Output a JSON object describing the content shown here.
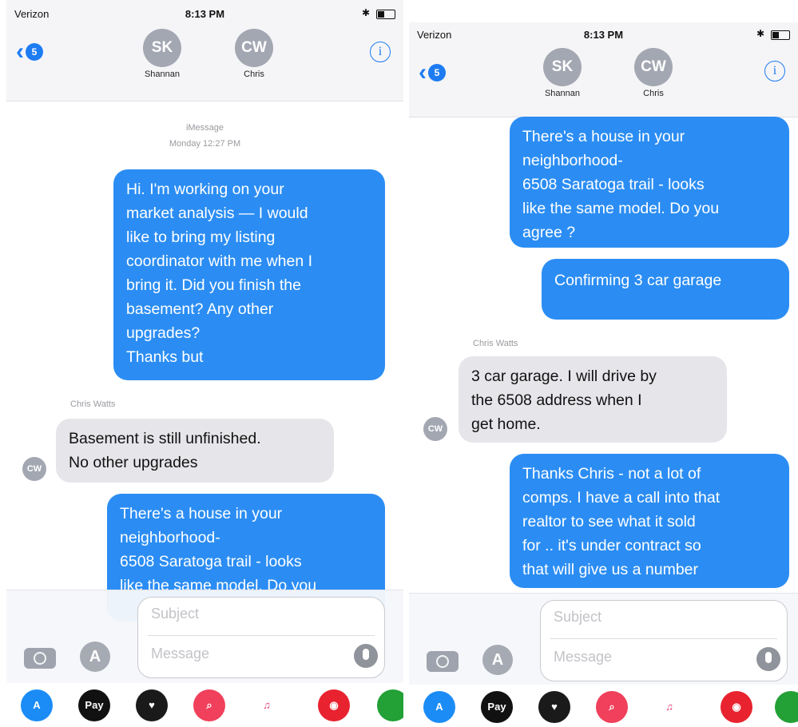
{
  "colors": {
    "outgoing": "#2b8df3",
    "incoming": "#e6e6ea",
    "accent": "#1e7cf2"
  },
  "left": {
    "status": {
      "carrier": "Verizon",
      "time": "8:13 PM"
    },
    "back_badge": "5",
    "contacts": [
      {
        "initials": "SK",
        "name": "Shannan"
      },
      {
        "initials": "CW",
        "name": "Chris"
      }
    ],
    "service_label": "iMessage",
    "timestamp": "Monday 12:27 PM",
    "messages": [
      {
        "text": "Hi.  I'm working on your\nmarket analysis — I would\nlike to bring my listing\ncoordinator with me when I\nbring it. Did you finish the\nbasement? Any other\nupgrades?\nThanks but"
      },
      {
        "sender": "Chris Watts",
        "text": "Basement is still unfinished.\nNo other upgrades",
        "avatar": "CW"
      },
      {
        "text": "There's a house in your\nneighborhood-\n6508 Saratoga trail - looks\nlike the same model. Do you"
      }
    ],
    "composer": {
      "subject_placeholder": "Subject",
      "message_placeholder": "Message"
    }
  },
  "right": {
    "status": {
      "carrier": "Verizon",
      "time": "8:13 PM"
    },
    "back_badge": "5",
    "contacts": [
      {
        "initials": "SK",
        "name": "Shannan"
      },
      {
        "initials": "CW",
        "name": "Chris"
      }
    ],
    "messages": [
      {
        "text": "There's a house in your\nneighborhood-\n6508 Saratoga trail - looks\nlike the same model. Do you\nagree ?"
      },
      {
        "text": "Confirming 3 car garage"
      },
      {
        "sender": "Chris Watts",
        "text": "3 car garage. I will drive by\nthe 6508 address when I\nget home.",
        "avatar": "CW"
      },
      {
        "text": "Thanks Chris  - not a lot of\ncomps. I have a call into that\nrealtor to see what it sold\nfor .. it's under contract so\nthat will give us a number"
      }
    ],
    "composer": {
      "subject_placeholder": "Subject",
      "message_placeholder": "Message"
    }
  },
  "tray_apps": [
    {
      "icon": "app-store-icon",
      "label": "A",
      "color": "#1b8cf6"
    },
    {
      "icon": "apple-pay-icon",
      "label": "Pay",
      "color": "#111111"
    },
    {
      "icon": "digital-touch-icon",
      "label": "♥",
      "color": "#1a1a1a"
    },
    {
      "icon": "images-search-icon",
      "label": "⌕",
      "color": "#f0405b"
    },
    {
      "icon": "music-icon",
      "label": "♫",
      "color": "#ffffff"
    },
    {
      "icon": "camera-app-icon",
      "label": "◉",
      "color": "#e8232f"
    },
    {
      "icon": "extra-app-icon",
      "label": "",
      "color": "#23a036"
    }
  ]
}
